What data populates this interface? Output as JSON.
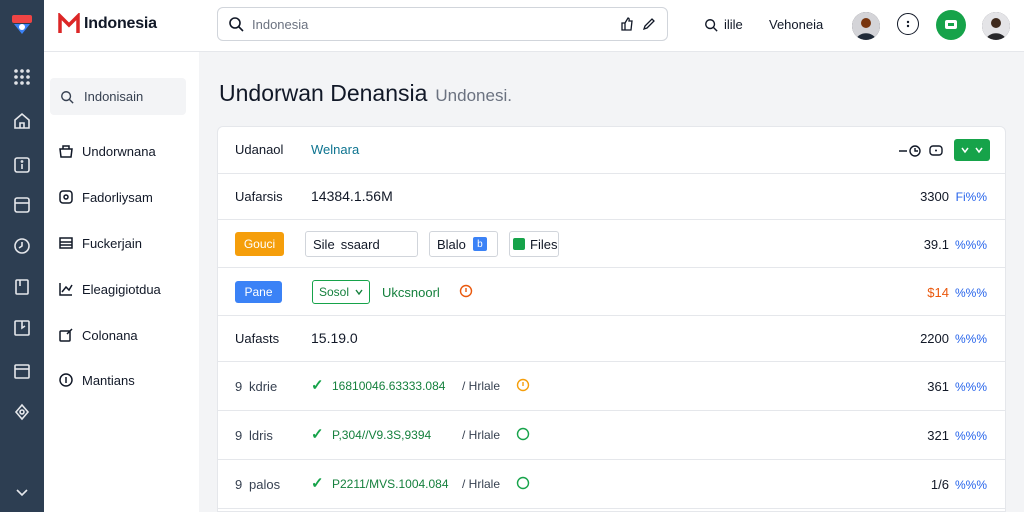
{
  "topbar": {
    "brand": "Indonesia",
    "search_placeholder": "Indonesia",
    "link_1": "ilile",
    "link_2": "Vehoneia"
  },
  "sidebar": {
    "search_label": "Indonisain",
    "items": [
      {
        "label": "Undorwnana",
        "icon": "basket-icon"
      },
      {
        "label": "Fadorliysam",
        "icon": "badge-icon"
      },
      {
        "label": "Fuckerjain",
        "icon": "list-icon"
      },
      {
        "label": "Eleagigiotdua",
        "icon": "chart-icon"
      },
      {
        "label": "Colonana",
        "icon": "edit-icon"
      },
      {
        "label": "Mantians",
        "icon": "coin-icon"
      }
    ]
  },
  "page": {
    "title": "Undorwan Denansia",
    "subtitle": "Undonesi."
  },
  "table": {
    "header": {
      "col1": "Udanaol",
      "col2": "Welnara"
    },
    "rows": [
      {
        "label": "Uafarsis",
        "value": "14384.1.56M",
        "amount": "3300",
        "pct": "Fi%%"
      },
      {
        "button": "Gouci",
        "field": "Sile",
        "field_text": "ssaard",
        "field2": "Blalo",
        "field2_tag": "b",
        "file_label": "Files",
        "amount": "39.1",
        "pct": "%%%"
      },
      {
        "button": "Pane",
        "select": "Sosol",
        "link": "Ukcsnoorl",
        "amount": "$14",
        "pct": "%%%"
      },
      {
        "label": "Uafasts",
        "value": "15.19.0",
        "amount": "2200",
        "pct": "%%%"
      },
      {
        "num": "9",
        "label": "kdrie",
        "text": "16810046.63333.084",
        "text_tail": "/ Hrlale",
        "amount": "361",
        "pct": "%%%"
      },
      {
        "num": "9",
        "label": "ldris",
        "text": "P,304//V9.3S,9394",
        "text_tail": "/ Hrlale",
        "amount": "321",
        "pct": "%%%"
      },
      {
        "num": "9",
        "label": "palos",
        "text": "P2211/MVS.1004.084",
        "text_tail": "/ Hrlale",
        "amount": "1/6",
        "pct": "%%%"
      }
    ]
  },
  "colors": {
    "rail": "#2d3e52",
    "accent_green": "#16a34a",
    "accent_orange": "#f59e0b",
    "accent_blue": "#3b82f6"
  }
}
